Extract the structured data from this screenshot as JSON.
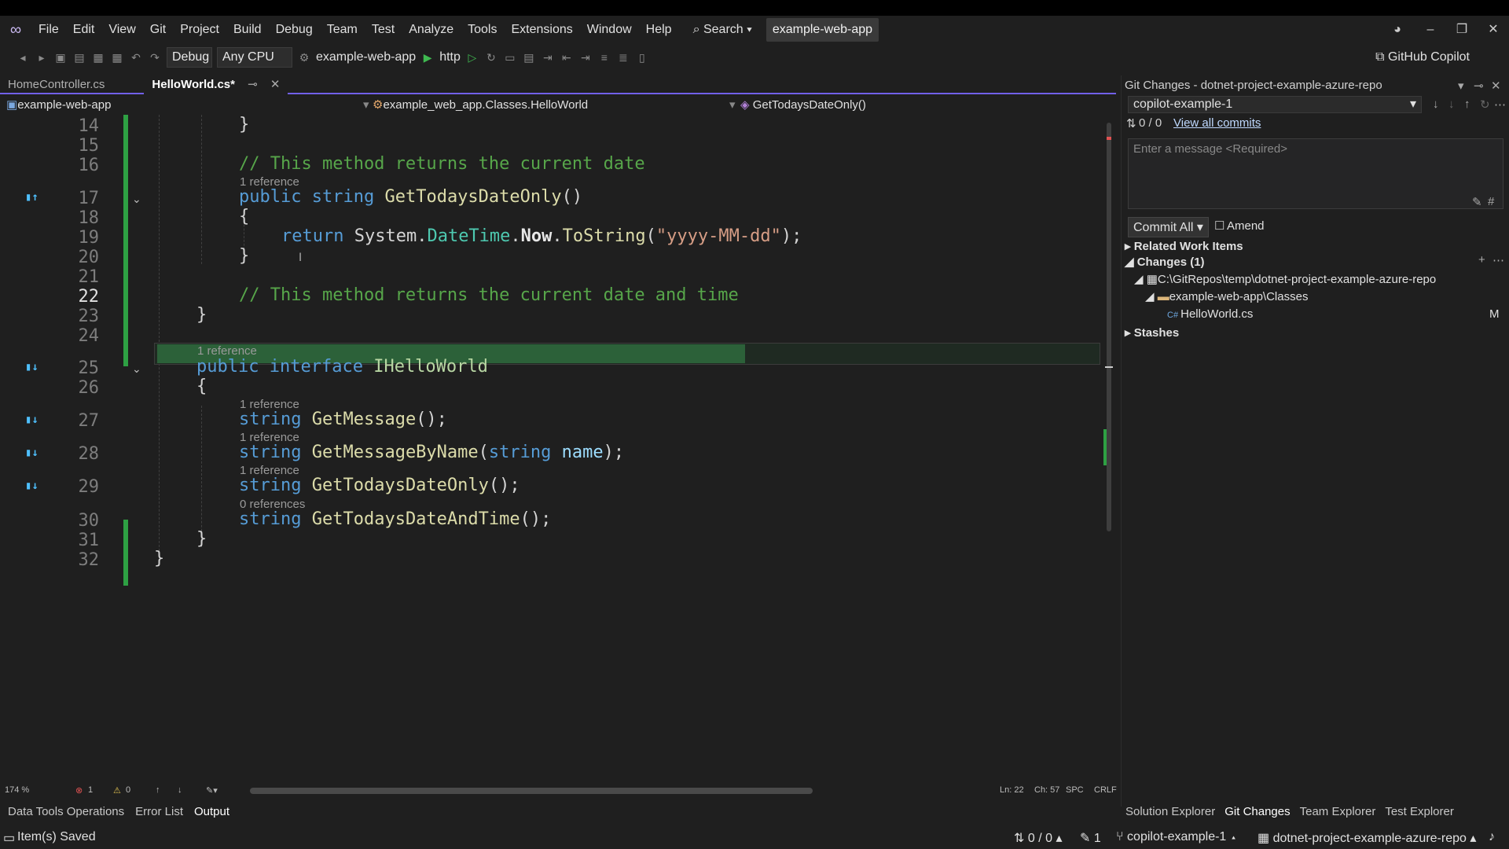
{
  "menu": {
    "items": [
      "File",
      "Edit",
      "View",
      "Git",
      "Project",
      "Build",
      "Debug",
      "Team",
      "Test",
      "Analyze",
      "Tools",
      "Extensions",
      "Window",
      "Help"
    ],
    "search": "Search",
    "solution_name": "example-web-app"
  },
  "toolbar": {
    "config": "Debug",
    "platform": "Any CPU",
    "startup_project": "example-web-app",
    "run_profile": "http",
    "copilot": "GitHub Copilot"
  },
  "tabs": [
    {
      "label": "HomeController.cs",
      "active": false
    },
    {
      "label": "HelloWorld.cs*",
      "active": true
    }
  ],
  "navbar": {
    "project": "example-web-app",
    "class": "example_web_app.Classes.HelloWorld",
    "member": "GetTodaysDateOnly()"
  },
  "code": {
    "line_numbers": [
      "14",
      "15",
      "16",
      "17",
      "18",
      "19",
      "20",
      "21",
      "22",
      "23",
      "24",
      "25",
      "26",
      "27",
      "28",
      "29",
      "30",
      "31",
      "32"
    ],
    "current_line": "22",
    "refs": {
      "r17": "1 reference",
      "r25": "1 reference",
      "r27": "1 reference",
      "r28": "1 reference",
      "r29": "1 reference",
      "r30": "0 references"
    },
    "l14": "}",
    "l16": "// This method returns the current date",
    "l17_kw1": "public",
    "l17_kw2": "string",
    "l17_fn": "GetTodaysDateOnly",
    "l17_p": "()",
    "l18": "{",
    "l19_kw": "return",
    "l19_ns": "System.",
    "l19_ty": "DateTime",
    "l19_dot1": ".",
    "l19_now": "Now",
    "l19_dot2": ".",
    "l19_fn": "ToString",
    "l19_p1": "(",
    "l19_str": "\"yyyy-MM-dd\"",
    "l19_p2": ");",
    "l20": "}",
    "l22": "// This method returns the current date and time",
    "l23": "}",
    "l25_kw1": "public",
    "l25_kw2": "interface",
    "l25_ty": "IHelloWorld",
    "l26": "{",
    "l27_kw": "string",
    "l27_fn": "GetMessage",
    "l27_p": "();",
    "l28_kw": "string",
    "l28_fn": "GetMessageByName",
    "l28_p1": "(",
    "l28_kw2": "string",
    "l28_param": "name",
    "l28_p2": ");",
    "l29_kw": "string",
    "l29_fn": "GetTodaysDateOnly",
    "l29_p": "();",
    "l30_kw": "string",
    "l30_fn": "GetTodaysDateAndTime",
    "l30_p": "();",
    "l31": "}",
    "l32": "}"
  },
  "editor_status": {
    "zoom": "174 %",
    "errors": "1",
    "warnings": "0",
    "ln": "Ln: 22",
    "ch": "Ch: 57",
    "spc": "SPC",
    "crlf": "CRLF"
  },
  "bottom_tabs": [
    "Data Tools Operations",
    "Error List",
    "Output"
  ],
  "bottom_active": "Output",
  "git": {
    "title": "Git Changes - dotnet-project-example-azure-repo",
    "branch": "copilot-example-1",
    "sync": "0 / 0",
    "view_commits": "View all commits",
    "message_placeholder": "Enter a message <Required>",
    "commit_all": "Commit All",
    "amend": "Amend",
    "related": "Related Work Items",
    "changes": "Changes (1)",
    "repo_path": "C:\\GitRepos\\temp\\dotnet-project-example-azure-repo",
    "folder": "example-web-app\\Classes",
    "file": "HelloWorld.cs",
    "file_status": "M",
    "stashes": "Stashes"
  },
  "right_tabs": [
    "Solution Explorer",
    "Git Changes",
    "Team Explorer",
    "Test Explorer"
  ],
  "right_active": "Git Changes",
  "statusbar": {
    "message": "Item(s) Saved",
    "sync": "0 / 0",
    "pending": "1",
    "branch": "copilot-example-1",
    "repo": "dotnet-project-example-azure-repo"
  }
}
